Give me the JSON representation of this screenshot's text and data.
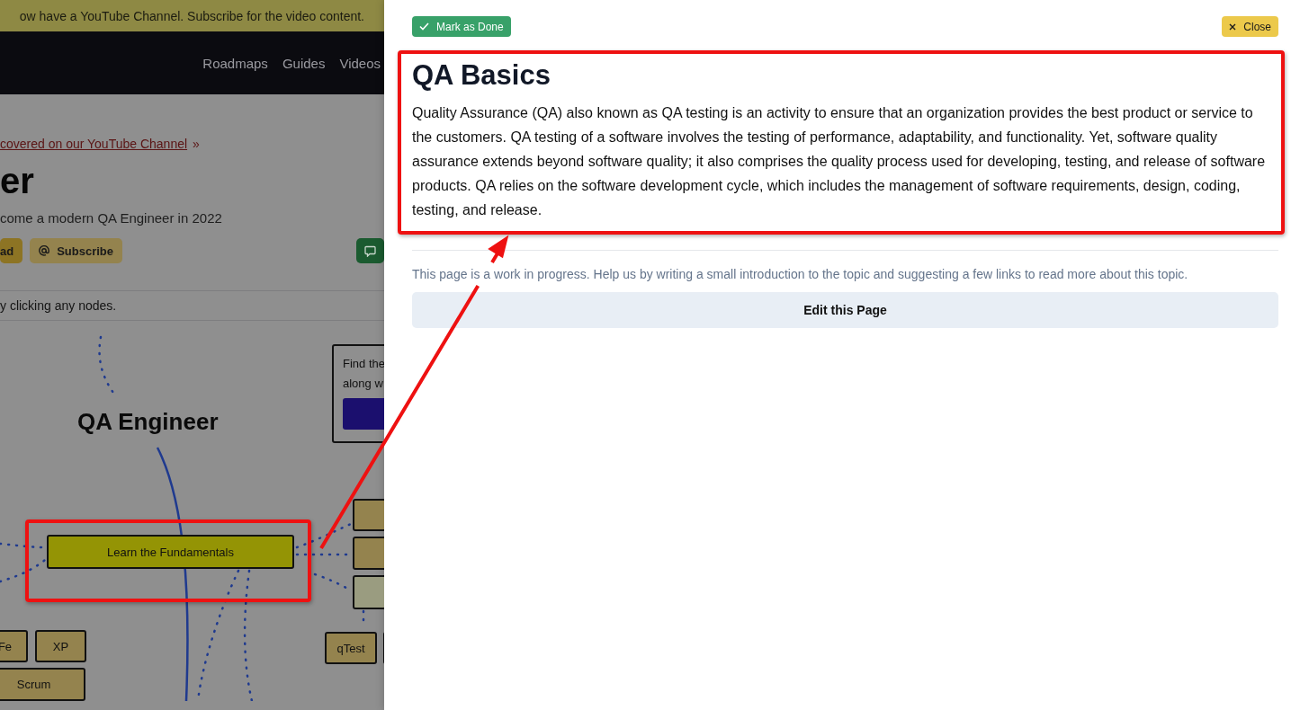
{
  "background_page": {
    "banner": "ow have a YouTube Channel. Subscribe for the video content.",
    "nav_links": [
      "Roadmaps",
      "Guides",
      "Videos"
    ],
    "video_link": "covered on our YouTube Channel",
    "video_link_suffix": "»",
    "title": "er",
    "subtitle": "come a modern QA Engineer in 2022",
    "buttons": [
      {
        "kind": "download",
        "label": "ad"
      },
      {
        "kind": "subscribe",
        "label": "Subscribe"
      },
      {
        "kind": "feedback"
      }
    ],
    "hint": "y clicking any nodes.",
    "roadmap": {
      "title": "QA Engineer",
      "promo_lines": [
        "Find the",
        "along w"
      ],
      "nodes": [
        {
          "kind": "main",
          "label": "Learn the Fundamentals"
        },
        {
          "kind": "sub"
        },
        {
          "kind": "sub"
        },
        {
          "kind": "sub-light"
        },
        {
          "kind": "sub",
          "label": "Fe"
        },
        {
          "kind": "sub",
          "label": "XP"
        },
        {
          "kind": "sub",
          "label": "Scrum"
        },
        {
          "kind": "sub",
          "label": "qTest"
        },
        {
          "kind": "sub"
        }
      ]
    }
  },
  "panel": {
    "mark_done": "Mark as Done",
    "close": "Close",
    "title": "QA Basics",
    "body": "Quality Assurance (QA) also known as QA testing is an activity to ensure that an organization provides the best product or service to the customers. QA testing of a software involves the testing of performance, adaptability, and functionality. Yet, software quality assurance extends beyond software quality; it also comprises the quality process used for developing, testing, and release of software products. QA relies on the software development cycle, which includes the management of software requirements, design, coding, testing, and release.",
    "note": "This page is a work in progress. Help us by writing a small introduction to the topic and suggesting a few links to read more about this topic.",
    "edit_button": "Edit this Page"
  }
}
